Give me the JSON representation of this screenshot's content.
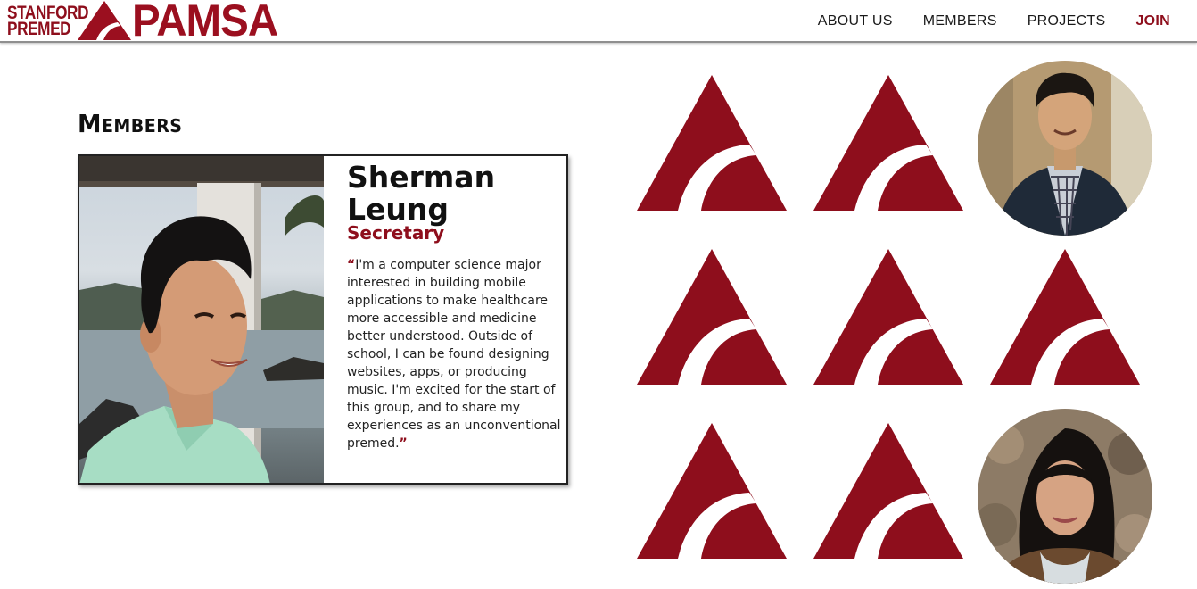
{
  "header": {
    "logo_line1": "STANFORD",
    "logo_line2": "PREMED",
    "logo_word": "PAMSA",
    "nav": [
      {
        "label": "ABOUT US"
      },
      {
        "label": "MEMBERS"
      },
      {
        "label": "PROJECTS"
      },
      {
        "label": "JOIN"
      }
    ]
  },
  "page": {
    "section_title": "Members"
  },
  "featured_member": {
    "name_line1": "Sherman",
    "name_line2": "Leung",
    "role": "Secretary",
    "quote": "I'm a computer science major interested in building mobile applications to make healthcare more accessible and medicine better understood. Outside of school, I can be found designing websites, apps, or producing music. I'm excited for the start of this group, and to share my experiences as an unconventional premed.",
    "open_quote": "“",
    "close_quote": "”"
  },
  "colors": {
    "brand": "#8e0e1c",
    "logo_red": "#9b0f1f"
  },
  "member_grid": [
    {
      "type": "logo-placeholder"
    },
    {
      "type": "logo-placeholder"
    },
    {
      "type": "photo",
      "icon": "avatar-male"
    },
    {
      "type": "logo-placeholder"
    },
    {
      "type": "logo-placeholder"
    },
    {
      "type": "logo-placeholder"
    },
    {
      "type": "logo-placeholder"
    },
    {
      "type": "logo-placeholder"
    },
    {
      "type": "photo",
      "icon": "avatar-female"
    }
  ]
}
